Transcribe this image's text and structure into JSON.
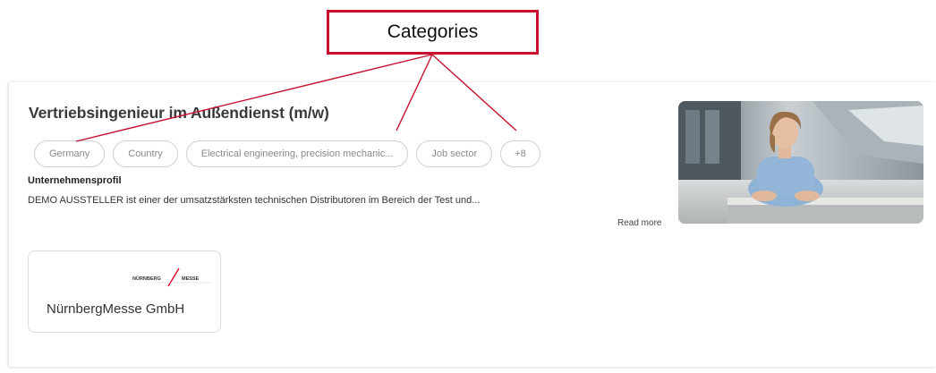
{
  "callout": {
    "label": "Categories",
    "color": "#c8102e"
  },
  "job": {
    "title": "Vertriebsingenieur im Außendienst (m/w)",
    "tags": [
      "Germany",
      "Country",
      "Electrical engineering, precision mechanic...",
      "Job sector"
    ],
    "more_tags": "+8",
    "section_heading": "Unternehmensprofil",
    "description": "DEMO AUSSTELLER ist einer der umsatzstärksten technischen Distributoren im Bereich der Test und...",
    "read_more": "Read more",
    "photo_icon": "portrait-photo"
  },
  "exhibitor": {
    "logo_left": "NÜRNBERG",
    "logo_right": "MESSE",
    "name": "NürnbergMesse GmbH",
    "logo_accent": "#e4002b"
  }
}
